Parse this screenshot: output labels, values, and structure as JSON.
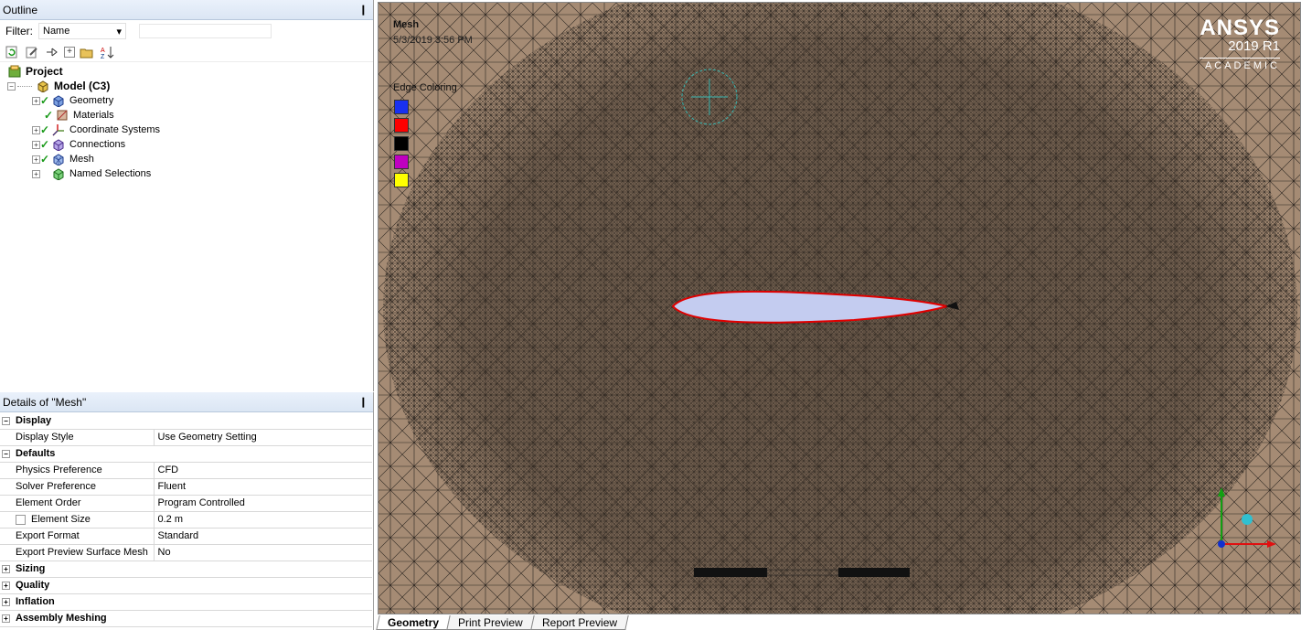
{
  "outline": {
    "title": "Outline",
    "pin": "❙",
    "filter_label": "Filter:",
    "filter_value": "Name",
    "tree": {
      "project": "Project",
      "model": "Model (C3)",
      "items": [
        "Geometry",
        "Materials",
        "Coordinate Systems",
        "Connections",
        "Mesh",
        "Named Selections"
      ]
    }
  },
  "details": {
    "title": "Details of \"Mesh\"",
    "sections": {
      "display": "Display",
      "defaults": "Defaults",
      "sizing": "Sizing",
      "quality": "Quality",
      "inflation": "Inflation",
      "assembly": "Assembly Meshing"
    },
    "rows": {
      "display_style": [
        "Display Style",
        "Use Geometry Setting"
      ],
      "physics": [
        "Physics Preference",
        "CFD"
      ],
      "solver": [
        "Solver Preference",
        "Fluent"
      ],
      "order": [
        "Element Order",
        "Program Controlled"
      ],
      "size": [
        "Element Size",
        "0.2 m"
      ],
      "export_format": [
        "Export Format",
        "Standard"
      ],
      "export_preview": [
        "Export Preview Surface Mesh",
        "No"
      ]
    }
  },
  "viewport": {
    "title": "Mesh",
    "date": "5/3/2019 3:56 PM",
    "legend_title": "Edge Coloring",
    "legend_colors": [
      "#1830f0",
      "#ff0000",
      "#000000",
      "#c000c0",
      "#ffff00"
    ],
    "brand": {
      "name": "ANSYS",
      "version": "2019 R1",
      "edition": "ACADEMIC"
    },
    "mesh_color": "#a58b74",
    "airfoil_fill": "#c4ccf0",
    "airfoil_edge": "#e00000"
  },
  "tabs": [
    "Geometry",
    "Print Preview",
    "Report Preview"
  ]
}
